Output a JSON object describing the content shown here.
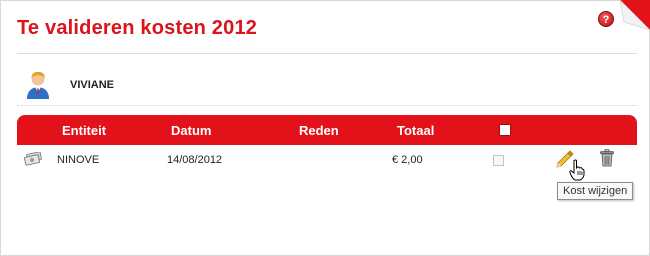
{
  "page": {
    "title": "Te valideren kosten 2012",
    "help_label": "?"
  },
  "user": {
    "name": "VIVIANE",
    "icon": "user-avatar-icon"
  },
  "table": {
    "columns": [
      "Entiteit",
      "Datum",
      "Reden",
      "Totaal"
    ],
    "rows": [
      {
        "entiteit": "NINOVE",
        "datum": "14/08/2012",
        "reden": "",
        "totaal": "€ 2,00"
      }
    ]
  },
  "tooltip": {
    "text": "Kost wijzigen"
  },
  "colors": {
    "accent": "#e3121a",
    "title": "#d9141b"
  }
}
